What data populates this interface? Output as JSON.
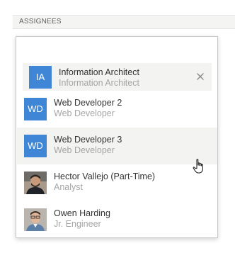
{
  "section": {
    "label": "ASSIGNEES"
  },
  "selected": {
    "initials": "IA",
    "name": "Information Architect",
    "role": "Information Architect",
    "avatar_color": "#3f87d6",
    "remove_icon": "close-icon"
  },
  "options": [
    {
      "initials": "WD",
      "name": "Web Developer 2",
      "role": "Web Developer",
      "avatar_color": "#3f87d6",
      "hover": false
    },
    {
      "initials": "WD",
      "name": "Web Developer 3",
      "role": "Web Developer",
      "avatar_color": "#3f87d6",
      "hover": true
    },
    {
      "name": "Hector Vallejo (Part-Time)",
      "role": "Analyst",
      "avatar": "photo"
    },
    {
      "name": "Owen Harding",
      "role": "Jr. Engineer",
      "avatar": "photo"
    }
  ],
  "colors": {
    "avatar": "#3f87d6",
    "hover_row": "#f3f3f1",
    "name_text": "#333333",
    "role_text": "#a5a5a5"
  },
  "cursor_icon": "hand-pointer-icon"
}
